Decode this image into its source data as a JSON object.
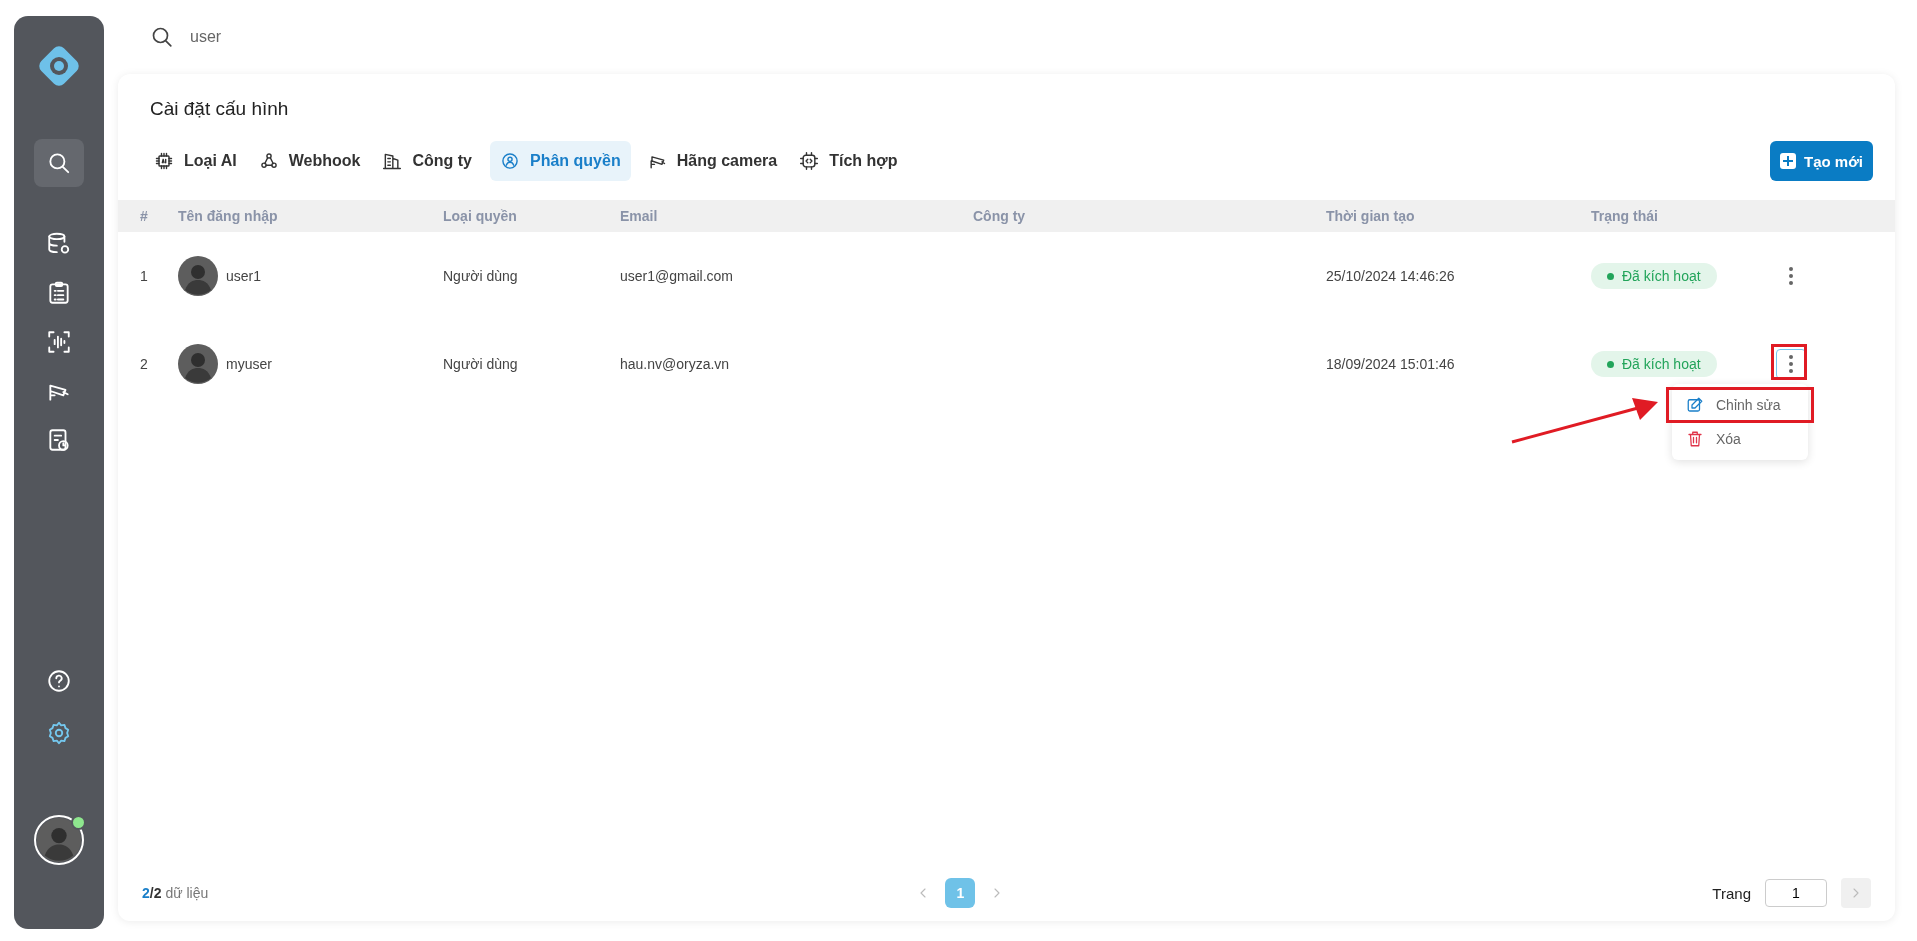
{
  "search": {
    "value": "user"
  },
  "sidebar": {
    "top_items": [
      {
        "selected": true
      },
      {
        "selected": false
      },
      {
        "selected": false
      },
      {
        "selected": false
      },
      {
        "selected": false
      },
      {
        "selected": false
      }
    ],
    "bottom_items": [
      {
        "selected": false
      },
      {
        "selected": true
      }
    ],
    "user": {
      "online": true
    }
  },
  "page": {
    "title": "Cài đặt cấu hình"
  },
  "tabs": [
    {
      "label": "Loại AI",
      "selected": false
    },
    {
      "label": "Webhook",
      "selected": false
    },
    {
      "label": "Công ty",
      "selected": false
    },
    {
      "label": "Phân quyền",
      "selected": true
    },
    {
      "label": "Hãng camera",
      "selected": false
    },
    {
      "label": "Tích hợp",
      "selected": false
    }
  ],
  "create_button": "Tạo mới",
  "table": {
    "columns": [
      "#",
      "Tên đăng nhập",
      "Loại quyền",
      "Email",
      "Công ty",
      "Thời gian tạo",
      "Trạng thái"
    ],
    "rows": [
      {
        "index": "1",
        "username": "user1",
        "role": "Người dùng",
        "email": "user1@gmail.com",
        "created": "25/10/2024 14:46:26",
        "status": "Đã kích hoạt",
        "menu_open": false
      },
      {
        "index": "2",
        "username": "myuser",
        "role": "Người dùng",
        "email": "hau.nv@oryza.vn",
        "created": "18/09/2024 15:01:46",
        "status": "Đã kích hoạt",
        "menu_open": true
      }
    ]
  },
  "row_menu": [
    {
      "kind": "edit",
      "label": "Chỉnh sửa",
      "highlighted": true
    },
    {
      "kind": "delete",
      "label": "Xóa",
      "highlighted": false
    }
  ],
  "footer": {
    "shown": "2",
    "total": "/2",
    "label": "dữ liệu",
    "pages": [
      {
        "label": "1",
        "selected": true
      }
    ],
    "page_label": "Trang",
    "page_input": "1"
  }
}
